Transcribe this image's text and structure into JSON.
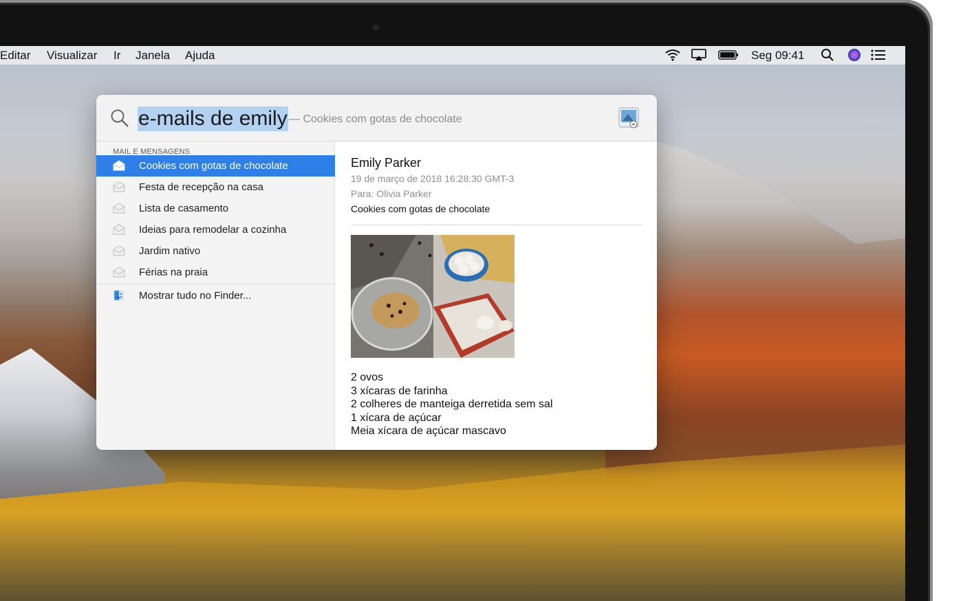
{
  "menubar": {
    "menus": [
      "Editar",
      "Visualizar",
      "Ir",
      "Janela",
      "Ajuda"
    ],
    "status_icons": [
      "wifi-icon",
      "airplay-icon",
      "battery-icon",
      "spotlight-search-icon",
      "siri-icon",
      "notification-center-icon"
    ],
    "clock": "Seg 09:41"
  },
  "spotlight": {
    "query": "e-mails de emily",
    "completion": "— Cookies com gotas de chocolate",
    "section_title": "MAIL E MENSAGENS",
    "results": [
      {
        "label": "Cookies com gotas de chocolate",
        "icon": "mail-icon",
        "selected": true
      },
      {
        "label": "Festa de recepção na casa",
        "icon": "mail-icon",
        "selected": false
      },
      {
        "label": "Lista de casamento",
        "icon": "mail-icon",
        "selected": false
      },
      {
        "label": "Ideias para remodelar a cozinha",
        "icon": "mail-icon",
        "selected": false
      },
      {
        "label": "Jardim nativo",
        "icon": "mail-icon",
        "selected": false
      },
      {
        "label": "Férias na praia",
        "icon": "mail-icon",
        "selected": false
      }
    ],
    "show_all": {
      "label": "Mostrar tudo no Finder...",
      "icon": "finder-icon"
    },
    "preview": {
      "sender": "Emily Parker",
      "date": "19 de março de 2018 16:28:30 GMT-3",
      "to": "Para: Olivia Parker",
      "subject": "Cookies com gotas de chocolate",
      "image": "cookie-dough-photo",
      "body_lines": [
        "2 ovos",
        "3 xícaras de farinha",
        "2 colheres de manteiga derretida sem sal",
        "1 xícara de açúcar",
        "Meia xícara de açúcar mascavo"
      ]
    }
  },
  "colors": {
    "selection": "#2f7fe8",
    "query_highlight": "#b3d2f2"
  }
}
